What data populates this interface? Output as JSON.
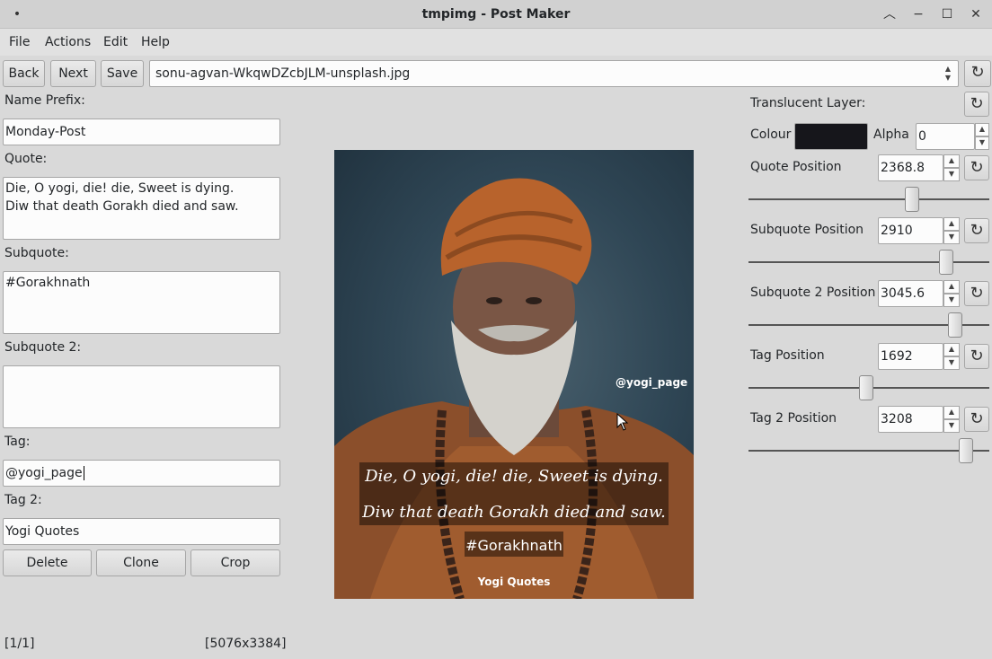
{
  "window": {
    "title": "tmpimg - Post Maker",
    "dot": "•",
    "min": "−",
    "max": "☐",
    "close": "✕",
    "shade": "︿"
  },
  "menu": [
    "File",
    "Actions",
    "Edit",
    "Help"
  ],
  "toolbar": {
    "back": "Back",
    "next": "Next",
    "save": "Save",
    "file": "sonu-agvan-WkqwDZcbJLM-unsplash.jpg"
  },
  "left": {
    "name_prefix_label": "Name Prefix:",
    "name_prefix": "Monday-Post",
    "quote_label": "Quote:",
    "quote_line1": "Die, O yogi, die! die, Sweet is dying.",
    "quote_line2": "Diw that death Gorakh died and saw.",
    "subquote_label": "Subquote:",
    "subquote": "#Gorakhnath",
    "subquote2_label": "Subquote 2:",
    "subquote2": "",
    "tag_label": "Tag:",
    "tag": "@yogi_page",
    "tag2_label": "Tag 2:",
    "tag2": "Yogi Quotes",
    "delete": "Delete",
    "clone": "Clone",
    "crop": "Crop"
  },
  "status": {
    "index": "[1/1]",
    "size": "[5076x3384]"
  },
  "right": {
    "translucent_label": "Translucent Layer:",
    "colour_label": "Colour",
    "colour_value": "#16161b",
    "alpha_label": "Alpha",
    "alpha": "0",
    "sliders": [
      {
        "label": "Quote Position",
        "value": "2368.8",
        "fraction": 0.69
      },
      {
        "label": "Subquote Position",
        "value": "2910",
        "fraction": 0.84
      },
      {
        "label": "Subquote 2 Position",
        "value": "3045.6",
        "fraction": 0.88
      },
      {
        "label": "Tag Position",
        "value": "1692",
        "fraction": 0.49
      },
      {
        "label": "Tag 2 Position",
        "value": "3208",
        "fraction": 0.93
      }
    ]
  },
  "preview": {
    "tag": "@yogi_page",
    "quote_line1": "Die, O yogi, die! die, Sweet is dying.",
    "quote_line2": "Diw that death Gorakh died and saw.",
    "subquote": "#Gorakhnath",
    "tag2": "Yogi Quotes"
  }
}
